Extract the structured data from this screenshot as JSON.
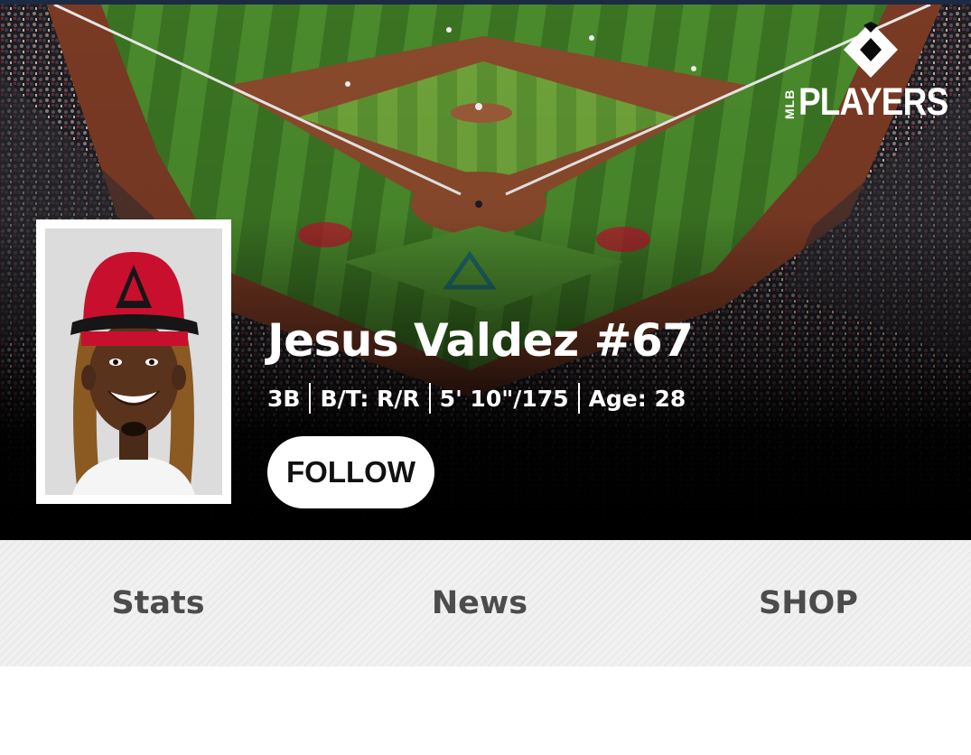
{
  "brand": {
    "logo_small": "MLB",
    "logo_word": "PLAYERS"
  },
  "player": {
    "name": "Jesus Valdez #67",
    "position": "3B",
    "bats_throws": "B/T: R/R",
    "height_weight": "5' 10\"/175",
    "age": "Age: 28"
  },
  "actions": {
    "follow_label": "FOLLOW"
  },
  "tabs": [
    {
      "label": "Stats"
    },
    {
      "label": "News"
    },
    {
      "label": "SHOP"
    }
  ],
  "icons": {
    "logo_mark": "diamond-logo-icon"
  },
  "colors": {
    "hero_bg": "#000000",
    "tab_text": "#4c4c4c",
    "tab_bg": "#f1f1f1",
    "cap_red": "#c8102e",
    "field_green": "#3e7a28",
    "dirt": "#7a3a24"
  }
}
